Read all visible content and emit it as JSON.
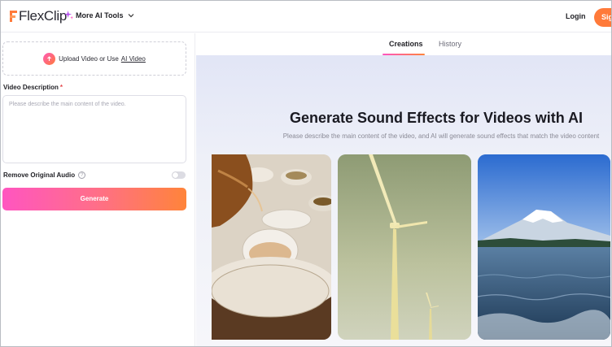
{
  "header": {
    "logo_text": "FlexClip",
    "ai_tools_label": "More AI Tools",
    "login_label": "Login",
    "signup_label": "Sig"
  },
  "left_panel": {
    "upload_text": "Upload Video or Use",
    "upload_link": "AI Video",
    "description_label": "Video Description",
    "required_mark": "*",
    "description_placeholder": "Please describe the main content of the video.",
    "remove_audio_label": "Remove Original Audio",
    "remove_audio_enabled": false,
    "generate_label": "Generate"
  },
  "right_panel": {
    "tabs": [
      {
        "label": "Creations",
        "active": true
      },
      {
        "label": "History",
        "active": false
      }
    ],
    "hero_title": "Generate Sound Effects for Videos with AI",
    "hero_subtitle": "Please describe the main content of the video, and AI will generate sound effects that match the video content",
    "sample_cards": [
      {
        "subject": "tea-pouring"
      },
      {
        "subject": "wind-turbine"
      },
      {
        "subject": "mount-fuji-lake"
      }
    ]
  },
  "colors": {
    "accent_pink": "#ff55c0",
    "accent_orange": "#ff843a",
    "required_red": "#e5484d"
  }
}
